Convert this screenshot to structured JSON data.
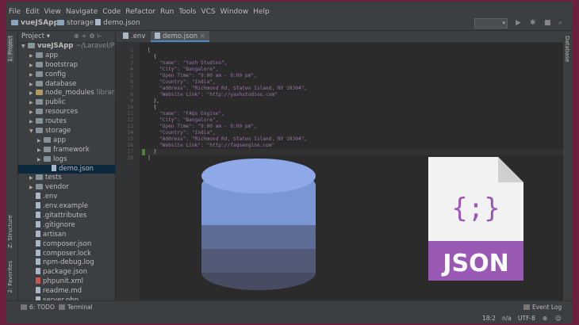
{
  "menu": [
    "File",
    "Edit",
    "View",
    "Navigate",
    "Code",
    "Refactor",
    "Run",
    "Tools",
    "VCS",
    "Window",
    "Help"
  ],
  "breadcrumb": [
    "vueJSApp",
    "storage",
    "demo.json"
  ],
  "project_panel": {
    "title": "Project",
    "tree": [
      {
        "label": "vueJSApp",
        "extra": "~/Laravel/Proje",
        "kind": "folder",
        "indent": 0,
        "open": true
      },
      {
        "label": "app",
        "kind": "folder",
        "indent": 1
      },
      {
        "label": "bootstrap",
        "kind": "folder",
        "indent": 1
      },
      {
        "label": "config",
        "kind": "folder",
        "indent": 1
      },
      {
        "label": "database",
        "kind": "folder",
        "indent": 1
      },
      {
        "label": "node_modules",
        "extra": "library ro",
        "kind": "lib",
        "indent": 1
      },
      {
        "label": "public",
        "kind": "folder",
        "indent": 1
      },
      {
        "label": "resources",
        "kind": "folder",
        "indent": 1
      },
      {
        "label": "routes",
        "kind": "folder",
        "indent": 1
      },
      {
        "label": "storage",
        "kind": "folder",
        "indent": 1,
        "open": true
      },
      {
        "label": "app",
        "kind": "folder",
        "indent": 2
      },
      {
        "label": "framework",
        "kind": "folder",
        "indent": 2
      },
      {
        "label": "logs",
        "kind": "folder",
        "indent": 2
      },
      {
        "label": "demo.json",
        "kind": "file",
        "indent": 3,
        "selected": true
      },
      {
        "label": "tests",
        "kind": "folder",
        "indent": 1
      },
      {
        "label": "vendor",
        "kind": "folder",
        "indent": 1
      },
      {
        "label": ".env",
        "kind": "file",
        "indent": 1
      },
      {
        "label": ".env.example",
        "kind": "file",
        "indent": 1
      },
      {
        "label": ".gitattributes",
        "kind": "file",
        "indent": 1
      },
      {
        "label": ".gitignore",
        "kind": "file",
        "indent": 1
      },
      {
        "label": "artisan",
        "kind": "file",
        "indent": 1
      },
      {
        "label": "composer.json",
        "kind": "file",
        "indent": 1
      },
      {
        "label": "composer.lock",
        "kind": "file",
        "indent": 1
      },
      {
        "label": "npm-debug.log",
        "kind": "file",
        "indent": 1
      },
      {
        "label": "package.json",
        "kind": "file",
        "indent": 1
      },
      {
        "label": "phpunit.xml",
        "kind": "red",
        "indent": 1
      },
      {
        "label": "readme.md",
        "kind": "file",
        "indent": 1
      },
      {
        "label": "server.php",
        "kind": "file",
        "indent": 1
      }
    ]
  },
  "left_tabs": [
    "1: Project",
    "Z: Structure",
    "2: Favorites"
  ],
  "right_tabs": [
    "Database"
  ],
  "tabs": [
    ".env",
    "demo.json"
  ],
  "code_lines": [
    "[",
    "  {",
    "    \"name\": \"Yash Studios\",",
    "    \"City\": \"Bangalore\",",
    "    \"Open Time\": \"9:00 am - 9:00 pm\",",
    "    \"Country\": \"India\",",
    "    \"address\": \"Richmond Rd, Staten Island, NY 10304\",",
    "    \"Website Link\": \"http://yashstudios.com\"",
    "  },",
    "  {",
    "    \"name\": \"FAQs Engine\",",
    "    \"City\": \"Bangalore\",",
    "    \"Open Time\": \"9:00 am - 9:00 pm\",",
    "    \"Country\": \"India\",",
    "    \"Address\": \"Richmond Rd, Staten Island, NY 10304\",",
    "    \"Website Link\": \"http://faqsengine.com\"",
    "  }",
    "]"
  ],
  "bottom_tools": [
    "6: TODO",
    "Terminal",
    "Event Log"
  ],
  "status": {
    "position": "18:2",
    "line_sep": "n/a",
    "encoding": "UTF-8"
  },
  "json_icon": {
    "glyph": "{;}",
    "label": "JSON",
    "color": "#9b59b6"
  },
  "database_icon": {
    "colors": [
      "#7b96d6",
      "#5e6d96",
      "#525a78",
      "#474c63"
    ]
  }
}
